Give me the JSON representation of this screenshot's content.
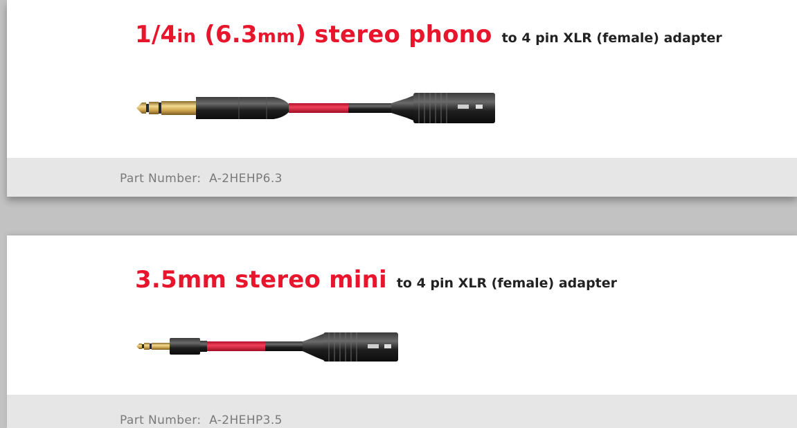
{
  "products": [
    {
      "title_parts": [
        "1/4",
        "in",
        " (6.3",
        "mm",
        ") stereo phono"
      ],
      "subtitle": "to  4 pin XLR (female) adapter",
      "part_label": "Part Number:",
      "part_number": "A-2HEHP6.3",
      "image_icon": "quarter-inch-trs-to-xlr-cable-icon"
    },
    {
      "title": "3.5mm stereo mini",
      "subtitle": "to  4 pin XLR (female) adapter",
      "part_label": "Part Number:",
      "part_number": "A-2HEHP3.5",
      "image_icon": "mini-jack-to-xlr-cable-icon"
    }
  ],
  "colors": {
    "title_red": "#e8162d",
    "cable_red": "#e21e3c",
    "page_background": "#c2c2c2",
    "footer_background": "#e6e6e6",
    "part_text": "#7a7a7a",
    "plug_gold": "#d8b25a",
    "connector_black": "#1e1e1e"
  }
}
